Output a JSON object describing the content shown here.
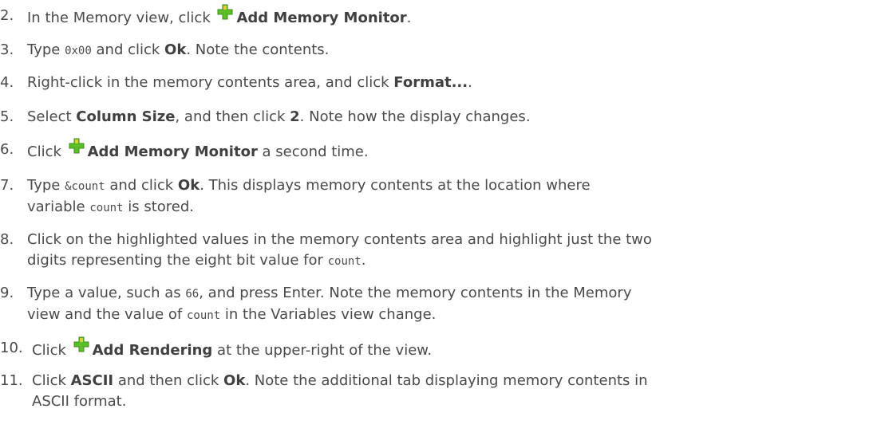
{
  "steps": [
    {
      "n": "2.",
      "parts": [
        {
          "t": "text",
          "v": "In the Memory view, click "
        },
        {
          "t": "icon",
          "v": "add-icon"
        },
        {
          "t": "bold",
          "v": "Add Memory Monitor"
        },
        {
          "t": "text",
          "v": "."
        }
      ]
    },
    {
      "n": "3.",
      "parts": [
        {
          "t": "text",
          "v": "Type "
        },
        {
          "t": "code",
          "v": "0x00"
        },
        {
          "t": "text",
          "v": " and click "
        },
        {
          "t": "bold",
          "v": "Ok"
        },
        {
          "t": "text",
          "v": ". Note the contents."
        }
      ]
    },
    {
      "n": "4.",
      "parts": [
        {
          "t": "text",
          "v": "Right-click in the memory contents area, and click "
        },
        {
          "t": "bold",
          "v": "Format..."
        },
        {
          "t": "text",
          "v": "."
        }
      ]
    },
    {
      "n": "5.",
      "parts": [
        {
          "t": "text",
          "v": "Select "
        },
        {
          "t": "bold",
          "v": "Column Size"
        },
        {
          "t": "text",
          "v": ", and then click "
        },
        {
          "t": "bold",
          "v": "2"
        },
        {
          "t": "text",
          "v": ". Note how the display changes."
        }
      ]
    },
    {
      "n": "6.",
      "parts": [
        {
          "t": "text",
          "v": "Click "
        },
        {
          "t": "icon",
          "v": "add-icon"
        },
        {
          "t": "bold",
          "v": "Add Memory Monitor"
        },
        {
          "t": "text",
          "v": " a second time."
        }
      ]
    },
    {
      "n": "7.",
      "parts": [
        {
          "t": "text",
          "v": "Type "
        },
        {
          "t": "code",
          "v": "&count"
        },
        {
          "t": "text",
          "v": " and click "
        },
        {
          "t": "bold",
          "v": "Ok"
        },
        {
          "t": "text",
          "v": ". This displays memory contents at the location where"
        },
        {
          "t": "br"
        },
        {
          "t": "text",
          "v": "variable "
        },
        {
          "t": "code",
          "v": "count"
        },
        {
          "t": "text",
          "v": " is stored."
        }
      ]
    },
    {
      "n": "8.",
      "parts": [
        {
          "t": "text",
          "v": "Click on the highlighted values in the memory contents area and highlight just the two"
        },
        {
          "t": "br"
        },
        {
          "t": "text",
          "v": "digits representing the eight bit value for "
        },
        {
          "t": "code",
          "v": "count"
        },
        {
          "t": "text",
          "v": "."
        }
      ]
    },
    {
      "n": "9.",
      "parts": [
        {
          "t": "text",
          "v": "Type a value, such as "
        },
        {
          "t": "code",
          "v": "66"
        },
        {
          "t": "text",
          "v": ", and press Enter.  Note the memory contents in the Memory"
        },
        {
          "t": "br"
        },
        {
          "t": "text",
          "v": "view and the value of "
        },
        {
          "t": "code",
          "v": "count"
        },
        {
          "t": "text",
          "v": " in the Variables view change."
        }
      ]
    },
    {
      "n": "10.",
      "parts": [
        {
          "t": "text",
          "v": "Click "
        },
        {
          "t": "icon",
          "v": "add-icon"
        },
        {
          "t": "bold",
          "v": "Add Rendering"
        },
        {
          "t": "text",
          "v": " at the upper-right of the view."
        }
      ]
    },
    {
      "n": "11.",
      "parts": [
        {
          "t": "text",
          "v": "Click "
        },
        {
          "t": "bold",
          "v": "ASCII"
        },
        {
          "t": "text",
          "v": " and then click "
        },
        {
          "t": "bold",
          "v": "Ok"
        },
        {
          "t": "text",
          "v": ". Note the additional tab displaying memory contents in"
        },
        {
          "t": "br"
        },
        {
          "t": "text",
          "v": "ASCII format."
        }
      ]
    }
  ],
  "colors": {
    "text": "#4a4a4a",
    "icon_green": "#5bbf2a",
    "icon_yellow": "#f2d43a"
  }
}
